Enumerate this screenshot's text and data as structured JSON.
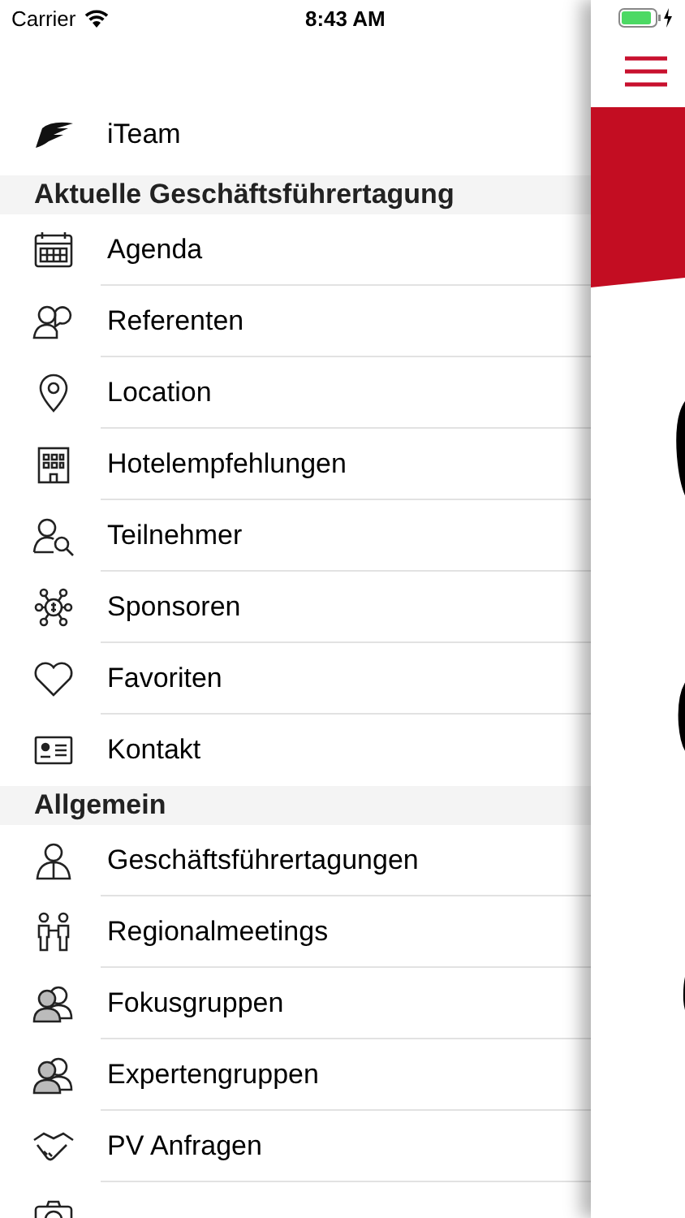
{
  "status_bar": {
    "carrier": "Carrier",
    "time": "8:43 AM"
  },
  "menu": {
    "brand": {
      "label": "iTeam"
    },
    "sections": [
      {
        "title": "Aktuelle Geschäftsführertagung",
        "items": [
          {
            "label": "Agenda"
          },
          {
            "label": "Referenten"
          },
          {
            "label": "Location"
          },
          {
            "label": "Hotelempfehlungen"
          },
          {
            "label": "Teilnehmer"
          },
          {
            "label": "Sponsoren"
          },
          {
            "label": "Favoriten"
          },
          {
            "label": "Kontakt"
          }
        ]
      },
      {
        "title": "Allgemein",
        "items": [
          {
            "label": "Geschäftsführertagungen"
          },
          {
            "label": "Regionalmeetings"
          },
          {
            "label": "Fokusgruppen"
          },
          {
            "label": "Expertengruppen"
          },
          {
            "label": "PV Anfragen"
          }
        ]
      }
    ]
  }
}
